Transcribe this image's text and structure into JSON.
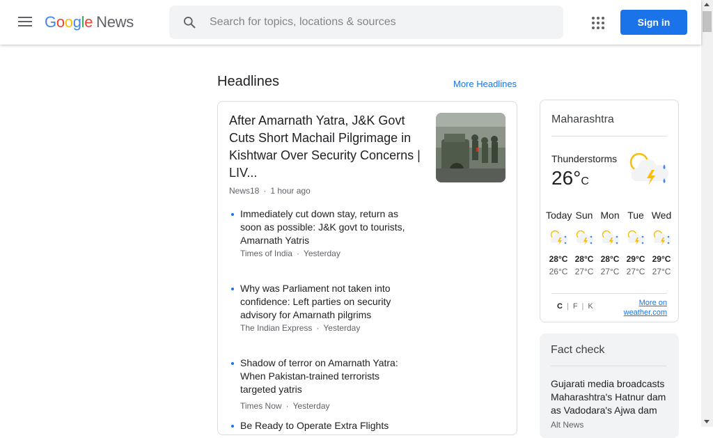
{
  "header": {
    "logo_google": [
      "G",
      "o",
      "o",
      "g",
      "l",
      "e"
    ],
    "logo_news": "News",
    "search_placeholder": "Search for topics, locations & sources",
    "signin_label": "Sign in"
  },
  "headlines": {
    "section_title": "Headlines",
    "more_link": "More Headlines",
    "top_story": {
      "title": "After Amarnath Yatra, J&K Govt Cuts Short Machail Pilgrimage in Kishtwar Over Security Concerns | LIV...",
      "source": "News18",
      "time": "1 hour ago"
    },
    "related": [
      {
        "title": "Immediately cut down stay, return as soon as possible: J&K govt to tourists, Amarnath Yatris",
        "source": "Times of India",
        "time": "Yesterday"
      },
      {
        "title": "Why was Parliament not taken into confidence: Left parties on security advisory for Amarnath pilgrims",
        "source": "The Indian Express",
        "time": "Yesterday"
      },
      {
        "title": "Shadow of terror on Amarnath Yatra: When Pakistan-trained terrorists targeted yatris",
        "source": "Times Now",
        "time": "Yesterday"
      },
      {
        "title": "Be Ready to Operate Extra Flights",
        "source": "",
        "time": ""
      }
    ]
  },
  "weather": {
    "location": "Maharashtra",
    "condition": "Thunderstorms",
    "temp": "26°",
    "unit": "C",
    "forecast": [
      {
        "day": "Today",
        "hi": "28°C",
        "lo": "26°C"
      },
      {
        "day": "Sun",
        "hi": "28°C",
        "lo": "27°C"
      },
      {
        "day": "Mon",
        "hi": "28°C",
        "lo": "27°C"
      },
      {
        "day": "Tue",
        "hi": "29°C",
        "lo": "27°C"
      },
      {
        "day": "Wed",
        "hi": "29°C",
        "lo": "27°C"
      }
    ],
    "units": [
      "C",
      "F",
      "K"
    ],
    "more_line1": "More on",
    "more_line2": "weather.com"
  },
  "fact_check": {
    "title": "Fact check",
    "item_title": "Gujarati media broadcasts Maharashtra's Hatnur dam as Vadodara's Ajwa dam",
    "item_source": "Alt News"
  },
  "colors": {
    "accent": "#1a73e8",
    "signin_bg": "#1a73e8",
    "search_bg": "#f1f3f4"
  }
}
